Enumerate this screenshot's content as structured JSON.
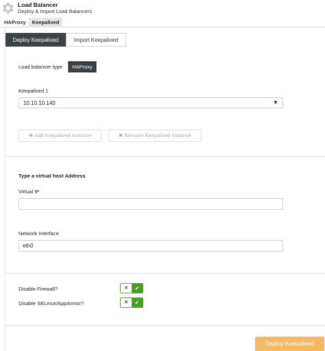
{
  "header": {
    "icon": "gear-icon",
    "title": "Load Balancer",
    "subtitle": "Deploy & Import Load Balancers"
  },
  "top_tabs": [
    {
      "label": "HAProxy",
      "active": false
    },
    {
      "label": "Keepalived",
      "active": true
    }
  ],
  "sub_tabs": [
    {
      "label": "Deploy Keepalived",
      "active": true
    },
    {
      "label": "Import Keepalived",
      "active": false
    }
  ],
  "form": {
    "lb_type_label": "Load balancer type",
    "lb_type_value": "HAProxy",
    "keepalived1_label": "Keepalived 1",
    "keepalived1_value": "10.10.10.140",
    "caret": "▼",
    "add_instance_label": "Add Keepalived Instance",
    "add_instance_icon": "✚",
    "remove_instance_label": "Remove Keepalived Instance",
    "remove_instance_icon": "✖",
    "vhost_heading": "Type a virtual host Address",
    "virtual_ip_label": "Virtual IP",
    "virtual_ip_value": "",
    "network_interface_label": "Network Interface",
    "network_interface_value": "eth0",
    "disable_firewall_label": "Disable Firewall?",
    "disable_selinux_label": "Disable SELinux/AppArmor?",
    "toggle_off_glyph": "✖",
    "toggle_on_glyph": "✔"
  },
  "colors": {
    "dark": "#3d4247",
    "toggle_green": "#4c9a2a",
    "deploy_orange": "#f5b865"
  },
  "deploy_button": "Deploy Keepalived"
}
